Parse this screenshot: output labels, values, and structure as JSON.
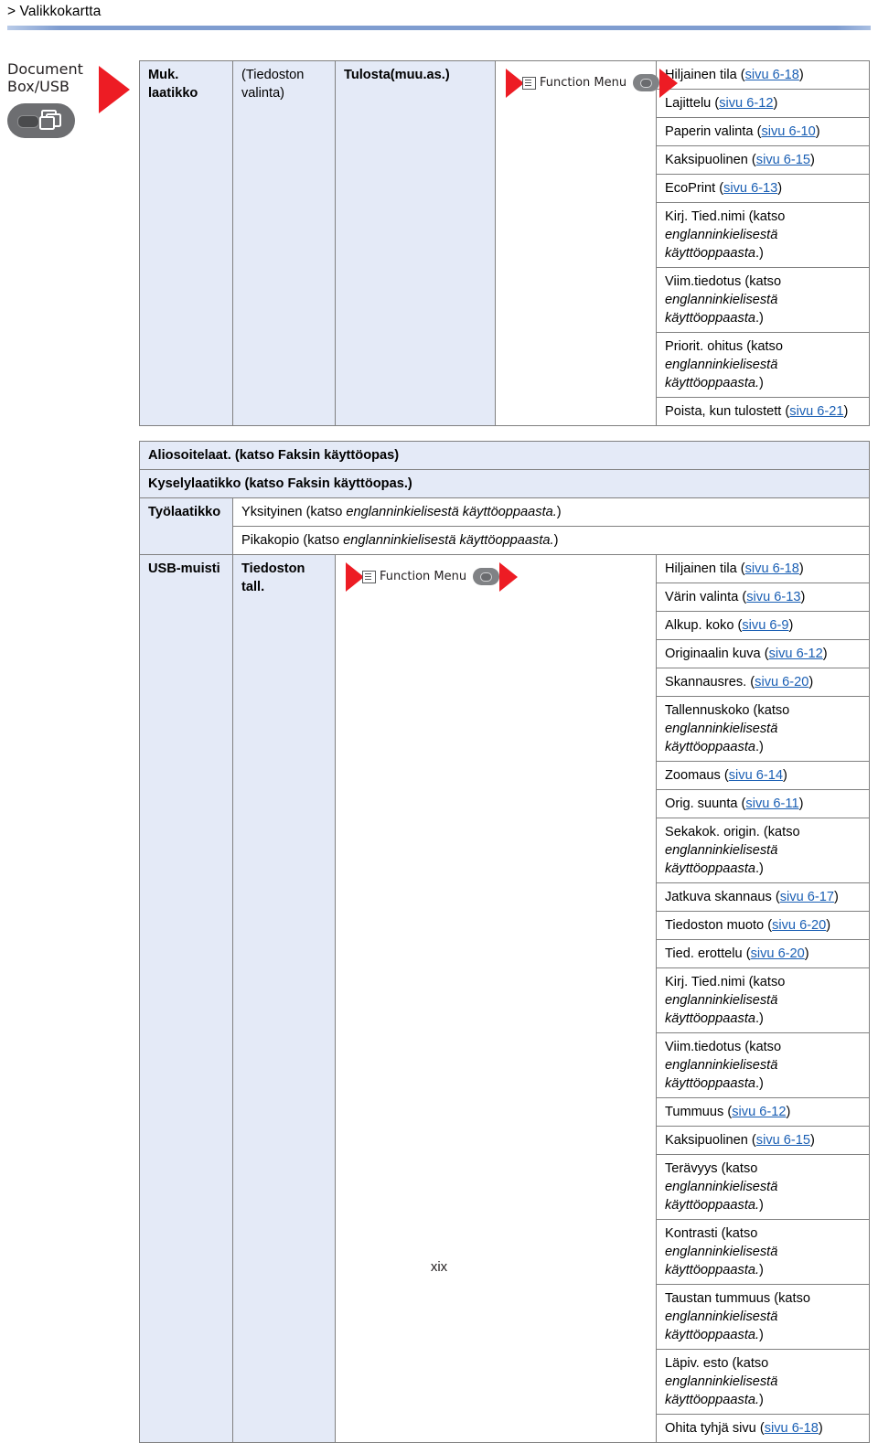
{
  "breadcrumb": "> Valikkokartta",
  "page_number": "xix",
  "colors": {
    "accent_rule": "#7f9dd0",
    "header_cell": "#e4eaf7",
    "arrow": "#ED1C24",
    "link": "#1a5fb4"
  },
  "left_block": {
    "line1": "Document",
    "line2": "Box/USB",
    "key_icon": "document-box-key-icon"
  },
  "function_menu": {
    "label": "Function Menu"
  },
  "section1": {
    "col1": "Muk. laatikko",
    "col2": "(Tiedoston valinta)",
    "col3": "Tulosta(muu.as.)",
    "items": [
      {
        "text": "Hiljainen tila (",
        "link": "sivu 6-18",
        "tail": ")"
      },
      {
        "text": "Lajittelu (",
        "link": "sivu 6-12",
        "tail": ")"
      },
      {
        "text": "Paperin valinta (",
        "link": "sivu 6-10",
        "tail": ")"
      },
      {
        "text": "Kaksipuolinen (",
        "link": "sivu 6-15",
        "tail": ")"
      },
      {
        "text": "EcoPrint (",
        "link": "sivu 6-13",
        "tail": ")"
      },
      {
        "text": "Kirj. Tied.nimi (katso ",
        "italic": "englanninkielisestä käyttöoppaasta",
        "tail": ".)"
      },
      {
        "text": "Viim.tiedotus (katso ",
        "italic": "englanninkielisestä käyttöoppaasta",
        "tail": ".)"
      },
      {
        "text": "Priorit. ohitus (katso ",
        "italic": "englanninkielisestä käyttöoppaasta.",
        "tail": ")"
      },
      {
        "text": "Poista, kun tulostett (",
        "link": "sivu 6-21",
        "tail": ")"
      }
    ]
  },
  "section2": {
    "aliosoitelaat": "Aliosoitelaat. (katso Faksin käyttöopas)",
    "kyselylaatikko": "Kyselylaatikko (katso Faksin käyttöopas.)",
    "tyolaatikko": "Työlaatikko",
    "tyolaatikko_items": [
      {
        "text": "Yksityinen (katso ",
        "italic": "englanninkielisestä käyttöoppaasta.",
        "tail": ")"
      },
      {
        "text": "Pikakopio (katso ",
        "italic": "englanninkielisestä käyttöoppaasta.",
        "tail": ")"
      }
    ]
  },
  "section3": {
    "col1": "USB-muisti",
    "col2": "Tiedoston tall.",
    "items": [
      {
        "text": "Hiljainen tila (",
        "link": "sivu 6-18",
        "tail": ")"
      },
      {
        "text": "Värin valinta (",
        "link": "sivu 6-13",
        "tail": ")"
      },
      {
        "text": "Alkup. koko (",
        "link": "sivu 6-9",
        "tail": ")"
      },
      {
        "text": "Originaalin kuva (",
        "link": "sivu 6-12",
        "tail": ")"
      },
      {
        "text": "Skannausres. (",
        "link": "sivu 6-20",
        "tail": ")"
      },
      {
        "text": "Tallennuskoko (katso ",
        "italic": "englanninkielisestä käyttöoppaasta",
        "tail": ".)"
      },
      {
        "text": "Zoomaus (",
        "link": "sivu 6-14",
        "tail": ")"
      },
      {
        "text": "Orig. suunta (",
        "link": "sivu 6-11",
        "tail": ")"
      },
      {
        "text": "Sekakok. origin. (katso ",
        "italic": "englanninkielisestä käyttöoppaasta",
        "tail": ".)"
      },
      {
        "text": "Jatkuva skannaus (",
        "link": "sivu 6-17",
        "tail": ")"
      },
      {
        "text": "Tiedoston muoto (",
        "link": "sivu 6-20",
        "tail": ")"
      },
      {
        "text": "Tied. erottelu (",
        "link": "sivu 6-20",
        "tail": ")"
      },
      {
        "text": "Kirj. Tied.nimi (katso ",
        "italic": "englanninkielisestä käyttöoppaasta",
        "tail": ".)"
      },
      {
        "text": "Viim.tiedotus (katso ",
        "italic": "englanninkielisestä käyttöoppaasta",
        "tail": ".)"
      },
      {
        "text": "Tummuus (",
        "link": "sivu 6-12",
        "tail": ")"
      },
      {
        "text": "Kaksipuolinen (",
        "link": "sivu 6-15",
        "tail": ")"
      },
      {
        "text": "Terävyys (katso ",
        "italic": "englanninkielisestä käyttöoppaasta.",
        "tail": ")"
      },
      {
        "text": "Kontrasti (katso ",
        "italic": "englanninkielisestä käyttöoppaasta.",
        "tail": ")"
      },
      {
        "text": "Taustan tummuus (katso ",
        "italic": "englanninkielisestä käyttöoppaasta.",
        "tail": ")"
      },
      {
        "text": "Läpiv. esto (katso ",
        "italic": "englanninkielisestä käyttöoppaasta.",
        "tail": ")"
      },
      {
        "text": "Ohita tyhjä sivu (",
        "link": "sivu 6-18",
        "tail": ")"
      }
    ]
  }
}
